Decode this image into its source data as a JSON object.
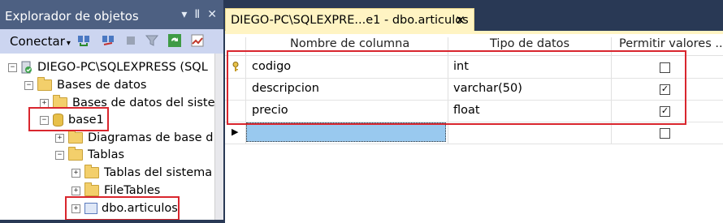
{
  "object_explorer": {
    "title": "Explorador de objetos",
    "title_buttons": [
      "▾",
      "Ⅱ",
      "✕"
    ],
    "toolbar": {
      "connect_label": "Conectar",
      "connect_arrow": "▾"
    },
    "tree": [
      {
        "label": "DIEGO-PC\\SQLEXPRESS (SQL",
        "expander": "−",
        "icon": "server"
      },
      {
        "label": "Bases de datos",
        "expander": "−",
        "icon": "folder"
      },
      {
        "label": "Bases de datos del siste",
        "expander": "+",
        "icon": "folder"
      },
      {
        "label": "base1",
        "expander": "−",
        "icon": "database"
      },
      {
        "label": "Diagramas de base d",
        "expander": "+",
        "icon": "folder"
      },
      {
        "label": "Tablas",
        "expander": "−",
        "icon": "folder"
      },
      {
        "label": "Tablas del sistema",
        "expander": "+",
        "icon": "folder"
      },
      {
        "label": "FileTables",
        "expander": "+",
        "icon": "folder"
      },
      {
        "label": "dbo.articulos",
        "expander": "+",
        "icon": "table"
      }
    ]
  },
  "designer": {
    "tab_title": "DIEGO-PC\\SQLEXPRE...e1 - dbo.articulos",
    "tab_close": "✕",
    "columns_header": [
      "Nombre de columna",
      "Tipo de datos",
      "Permitir valores ..."
    ],
    "rows": [
      {
        "name": "codigo",
        "type": "int",
        "allow_nulls": false,
        "primary_key": true
      },
      {
        "name": "descripcion",
        "type": "varchar(50)",
        "allow_nulls": true,
        "primary_key": false
      },
      {
        "name": "precio",
        "type": "float",
        "allow_nulls": true,
        "primary_key": false
      },
      {
        "name": "",
        "type": "",
        "allow_nulls": false,
        "primary_key": false,
        "new_row": true
      }
    ],
    "checked_mark": "✓"
  },
  "colors": {
    "highlight_border": "#d9262e",
    "tab_background": "#fff4c3",
    "panel_title": "#4d6082",
    "selection": "#99c9ef"
  }
}
